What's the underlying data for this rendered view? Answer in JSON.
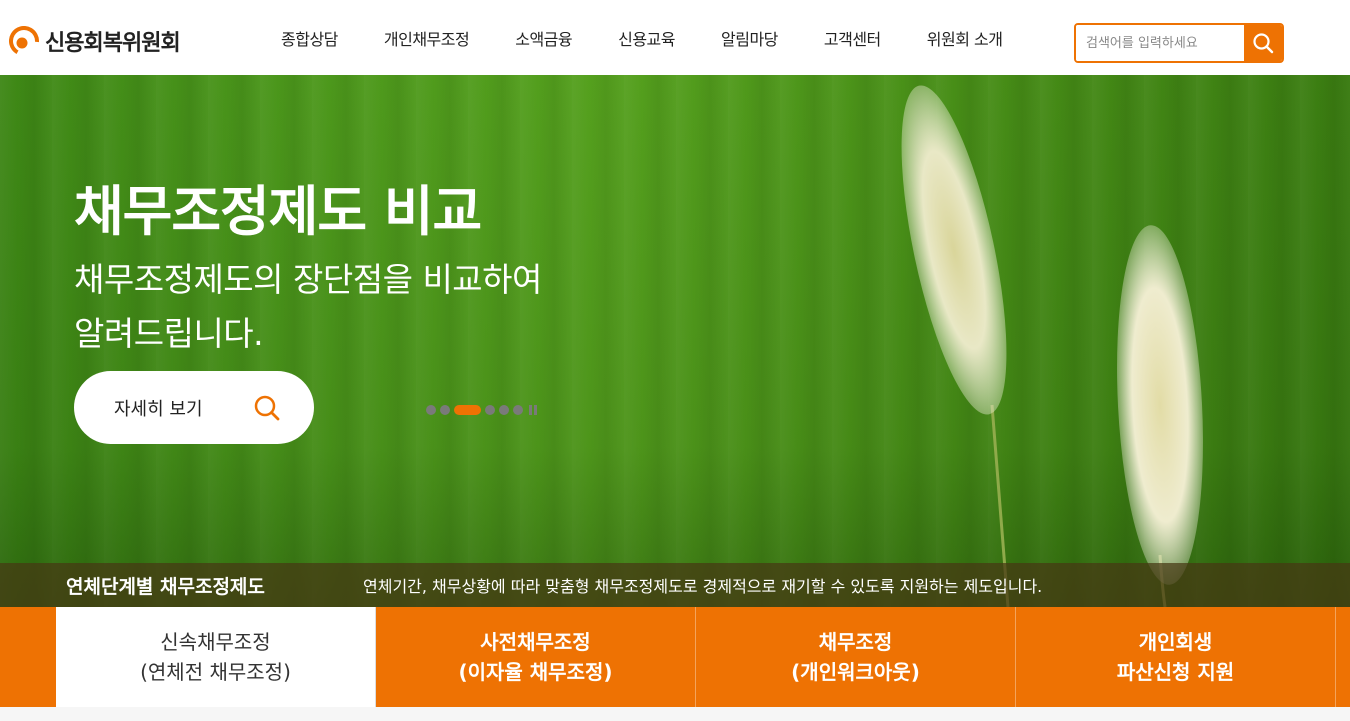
{
  "header": {
    "logo_text": "신용회복위원회",
    "nav": [
      "종합상담",
      "개인채무조정",
      "소액금융",
      "신용교육",
      "알림마당",
      "고객센터",
      "위원회 소개"
    ],
    "search": {
      "placeholder": "검색어를 입력하세요"
    }
  },
  "hero": {
    "title": "채무조정제도 비교",
    "subtitle_line1": "채무조정제도의 장단점을 비교하여",
    "subtitle_line2": "알려드립니다.",
    "button_label": "자세히 보기",
    "slides_count": 6,
    "active_slide": 3
  },
  "info_bar": {
    "title": "연체단계별 채무조정제도",
    "description": "연체기간, 채무상황에 따라 맞춤형 채무조정제도로 경제적으로 재기할 수 있도록 지원하는 제도입니다."
  },
  "tabs": [
    {
      "line1": "신속채무조정",
      "line2": "(연체전 채무조정)",
      "active": true
    },
    {
      "line1": "사전채무조정",
      "line2": "(이자율 채무조정)",
      "active": false
    },
    {
      "line1": "채무조정",
      "line2": "(개인워크아웃)",
      "active": false
    },
    {
      "line1": "개인회생",
      "line2": "파산신청 지원",
      "active": false
    }
  ],
  "colors": {
    "accent": "#ee7203",
    "hero_green": "#58a51f"
  }
}
